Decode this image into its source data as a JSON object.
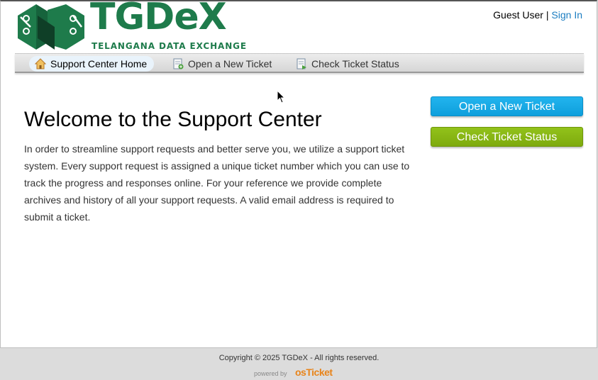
{
  "brand": {
    "name": "TGDeX",
    "name_part1": "TGD",
    "name_part2": "e",
    "name_part3": "X",
    "tagline": "TELANGANA DATA EXCHANGE",
    "color": "#1e7b4b"
  },
  "user": {
    "guest_label": "Guest User",
    "separator": "|",
    "sign_in": "Sign In"
  },
  "nav": {
    "items": [
      {
        "label": "Support Center Home",
        "icon": "home-icon",
        "active": true
      },
      {
        "label": "Open a New Ticket",
        "icon": "new-ticket-icon",
        "active": false
      },
      {
        "label": "Check Ticket Status",
        "icon": "ticket-status-icon",
        "active": false
      }
    ]
  },
  "main": {
    "title": "Welcome to the Support Center",
    "body": "In order to streamline support requests and better serve you, we utilize a support ticket system. Every support request is assigned a unique ticket number which you can use to track the progress and responses online. For your reference we provide complete archives and history of all your support requests. A valid email address is required to submit a ticket."
  },
  "sidebar": {
    "open_ticket": "Open a New Ticket",
    "check_status": "Check Ticket Status",
    "open_color": "#1aa9e6",
    "check_color": "#88b814"
  },
  "footer": {
    "copyright": "Copyright © 2025 TGDeX - All rights reserved.",
    "powered_by": "powered by",
    "os_prefix": "os",
    "os_name": "Ticket"
  }
}
